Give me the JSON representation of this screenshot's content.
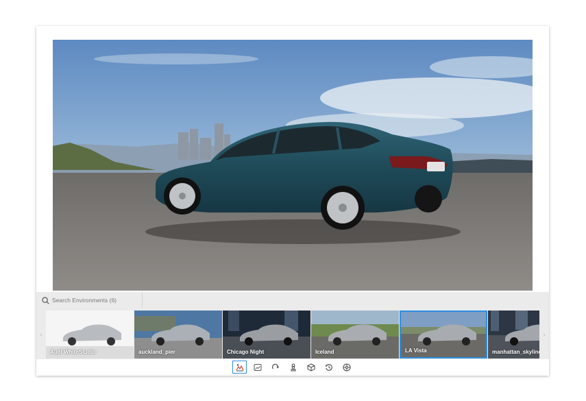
{
  "search": {
    "placeholder": "Search Environments (6)"
  },
  "carousel": {
    "prev_icon": "chevron-left-icon",
    "next_icon": "chevron-right-icon",
    "environments": [
      {
        "label": "Audi WhiteStudio",
        "selected": false
      },
      {
        "label": "auckland_pier",
        "selected": false
      },
      {
        "label": "Chicago Night",
        "selected": false
      },
      {
        "label": "Iceland",
        "selected": false
      },
      {
        "label": "LA Vista",
        "selected": true
      },
      {
        "label": "manhattan_skyline",
        "selected": false
      }
    ]
  },
  "toolbar": {
    "tools": [
      {
        "icon": "environment-icon",
        "active": true
      },
      {
        "icon": "background-image-icon",
        "active": false
      },
      {
        "icon": "rotate-icon",
        "active": false
      },
      {
        "icon": "chess-pawn-icon",
        "active": false
      },
      {
        "icon": "cube-icon",
        "active": false
      },
      {
        "icon": "history-icon",
        "active": false
      },
      {
        "icon": "wheel-icon",
        "active": false
      }
    ]
  },
  "colors": {
    "accent": "#2e8ee0",
    "car_body": "#1f4a58",
    "panel_bg": "#ebebeb"
  }
}
